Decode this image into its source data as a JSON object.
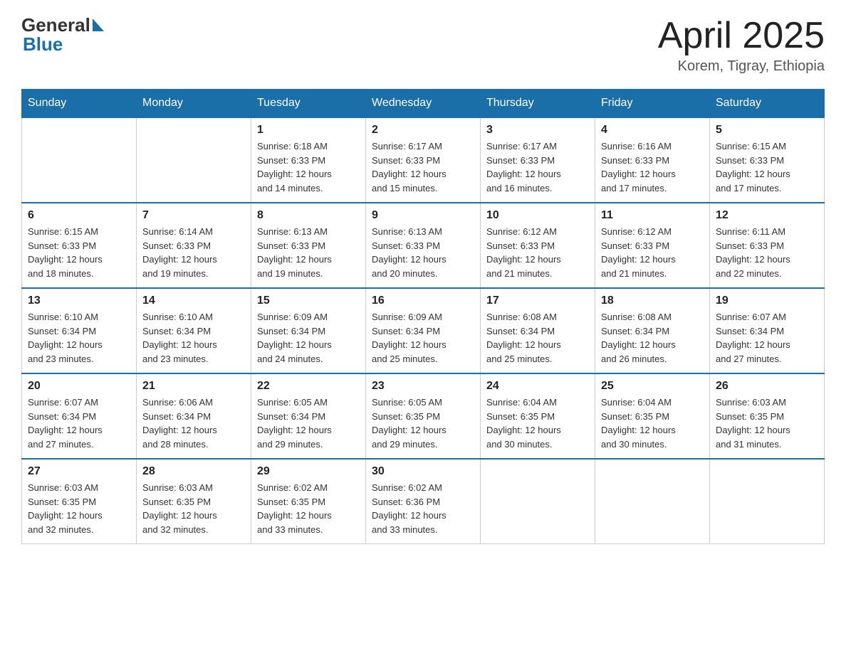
{
  "header": {
    "logo_general": "General",
    "logo_blue": "Blue",
    "title": "April 2025",
    "location": "Korem, Tigray, Ethiopia"
  },
  "days_of_week": [
    "Sunday",
    "Monday",
    "Tuesday",
    "Wednesday",
    "Thursday",
    "Friday",
    "Saturday"
  ],
  "weeks": [
    [
      {
        "day": "",
        "info": ""
      },
      {
        "day": "",
        "info": ""
      },
      {
        "day": "1",
        "info": "Sunrise: 6:18 AM\nSunset: 6:33 PM\nDaylight: 12 hours\nand 14 minutes."
      },
      {
        "day": "2",
        "info": "Sunrise: 6:17 AM\nSunset: 6:33 PM\nDaylight: 12 hours\nand 15 minutes."
      },
      {
        "day": "3",
        "info": "Sunrise: 6:17 AM\nSunset: 6:33 PM\nDaylight: 12 hours\nand 16 minutes."
      },
      {
        "day": "4",
        "info": "Sunrise: 6:16 AM\nSunset: 6:33 PM\nDaylight: 12 hours\nand 17 minutes."
      },
      {
        "day": "5",
        "info": "Sunrise: 6:15 AM\nSunset: 6:33 PM\nDaylight: 12 hours\nand 17 minutes."
      }
    ],
    [
      {
        "day": "6",
        "info": "Sunrise: 6:15 AM\nSunset: 6:33 PM\nDaylight: 12 hours\nand 18 minutes."
      },
      {
        "day": "7",
        "info": "Sunrise: 6:14 AM\nSunset: 6:33 PM\nDaylight: 12 hours\nand 19 minutes."
      },
      {
        "day": "8",
        "info": "Sunrise: 6:13 AM\nSunset: 6:33 PM\nDaylight: 12 hours\nand 19 minutes."
      },
      {
        "day": "9",
        "info": "Sunrise: 6:13 AM\nSunset: 6:33 PM\nDaylight: 12 hours\nand 20 minutes."
      },
      {
        "day": "10",
        "info": "Sunrise: 6:12 AM\nSunset: 6:33 PM\nDaylight: 12 hours\nand 21 minutes."
      },
      {
        "day": "11",
        "info": "Sunrise: 6:12 AM\nSunset: 6:33 PM\nDaylight: 12 hours\nand 21 minutes."
      },
      {
        "day": "12",
        "info": "Sunrise: 6:11 AM\nSunset: 6:33 PM\nDaylight: 12 hours\nand 22 minutes."
      }
    ],
    [
      {
        "day": "13",
        "info": "Sunrise: 6:10 AM\nSunset: 6:34 PM\nDaylight: 12 hours\nand 23 minutes."
      },
      {
        "day": "14",
        "info": "Sunrise: 6:10 AM\nSunset: 6:34 PM\nDaylight: 12 hours\nand 23 minutes."
      },
      {
        "day": "15",
        "info": "Sunrise: 6:09 AM\nSunset: 6:34 PM\nDaylight: 12 hours\nand 24 minutes."
      },
      {
        "day": "16",
        "info": "Sunrise: 6:09 AM\nSunset: 6:34 PM\nDaylight: 12 hours\nand 25 minutes."
      },
      {
        "day": "17",
        "info": "Sunrise: 6:08 AM\nSunset: 6:34 PM\nDaylight: 12 hours\nand 25 minutes."
      },
      {
        "day": "18",
        "info": "Sunrise: 6:08 AM\nSunset: 6:34 PM\nDaylight: 12 hours\nand 26 minutes."
      },
      {
        "day": "19",
        "info": "Sunrise: 6:07 AM\nSunset: 6:34 PM\nDaylight: 12 hours\nand 27 minutes."
      }
    ],
    [
      {
        "day": "20",
        "info": "Sunrise: 6:07 AM\nSunset: 6:34 PM\nDaylight: 12 hours\nand 27 minutes."
      },
      {
        "day": "21",
        "info": "Sunrise: 6:06 AM\nSunset: 6:34 PM\nDaylight: 12 hours\nand 28 minutes."
      },
      {
        "day": "22",
        "info": "Sunrise: 6:05 AM\nSunset: 6:34 PM\nDaylight: 12 hours\nand 29 minutes."
      },
      {
        "day": "23",
        "info": "Sunrise: 6:05 AM\nSunset: 6:35 PM\nDaylight: 12 hours\nand 29 minutes."
      },
      {
        "day": "24",
        "info": "Sunrise: 6:04 AM\nSunset: 6:35 PM\nDaylight: 12 hours\nand 30 minutes."
      },
      {
        "day": "25",
        "info": "Sunrise: 6:04 AM\nSunset: 6:35 PM\nDaylight: 12 hours\nand 30 minutes."
      },
      {
        "day": "26",
        "info": "Sunrise: 6:03 AM\nSunset: 6:35 PM\nDaylight: 12 hours\nand 31 minutes."
      }
    ],
    [
      {
        "day": "27",
        "info": "Sunrise: 6:03 AM\nSunset: 6:35 PM\nDaylight: 12 hours\nand 32 minutes."
      },
      {
        "day": "28",
        "info": "Sunrise: 6:03 AM\nSunset: 6:35 PM\nDaylight: 12 hours\nand 32 minutes."
      },
      {
        "day": "29",
        "info": "Sunrise: 6:02 AM\nSunset: 6:35 PM\nDaylight: 12 hours\nand 33 minutes."
      },
      {
        "day": "30",
        "info": "Sunrise: 6:02 AM\nSunset: 6:36 PM\nDaylight: 12 hours\nand 33 minutes."
      },
      {
        "day": "",
        "info": ""
      },
      {
        "day": "",
        "info": ""
      },
      {
        "day": "",
        "info": ""
      }
    ]
  ]
}
